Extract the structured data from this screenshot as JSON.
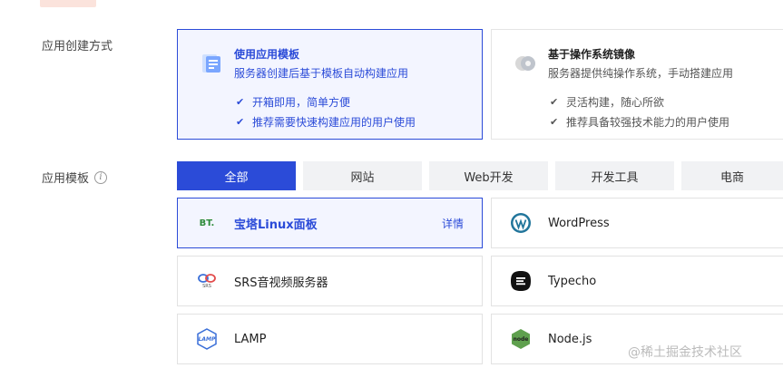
{
  "creation": {
    "label": "应用创建方式",
    "cards": [
      {
        "title": "使用应用模板",
        "desc": "服务器创建后基于模板自动构建应用",
        "features": [
          "开箱即用，简单方便",
          "推荐需要快速构建应用的用户使用"
        ],
        "icon": "template-icon",
        "selected": true
      },
      {
        "title": "基于操作系统镜像",
        "desc": "服务器提供纯操作系统，手动搭建应用",
        "features": [
          "灵活构建，随心所欲",
          "推荐具备较强技术能力的用户使用"
        ],
        "icon": "os-image-icon",
        "selected": false
      }
    ]
  },
  "templates": {
    "label": "应用模板",
    "tabs": [
      "全部",
      "网站",
      "Web开发",
      "开发工具",
      "电商"
    ],
    "active_tab": "全部",
    "items": [
      {
        "name": "宝塔Linux面板",
        "icon": "bt-panel-icon",
        "logo_text": "BT.",
        "detail": "详情",
        "selected": true
      },
      {
        "name": "WordPress",
        "icon": "wordpress-icon"
      },
      {
        "name": "SRS音视频服务器",
        "icon": "srs-icon",
        "logo_text": "SRS"
      },
      {
        "name": "Typecho",
        "icon": "typecho-icon"
      },
      {
        "name": "LAMP",
        "icon": "lamp-icon",
        "logo_text": "LAMP"
      },
      {
        "name": "Node.js",
        "icon": "nodejs-icon",
        "logo_text": "node"
      }
    ]
  },
  "watermark": "@稀土掘金技术社区",
  "colors": {
    "accent": "#2b4bd8",
    "selected_bg": "#f3f5ff",
    "tab_bg": "#f1f2f4"
  }
}
